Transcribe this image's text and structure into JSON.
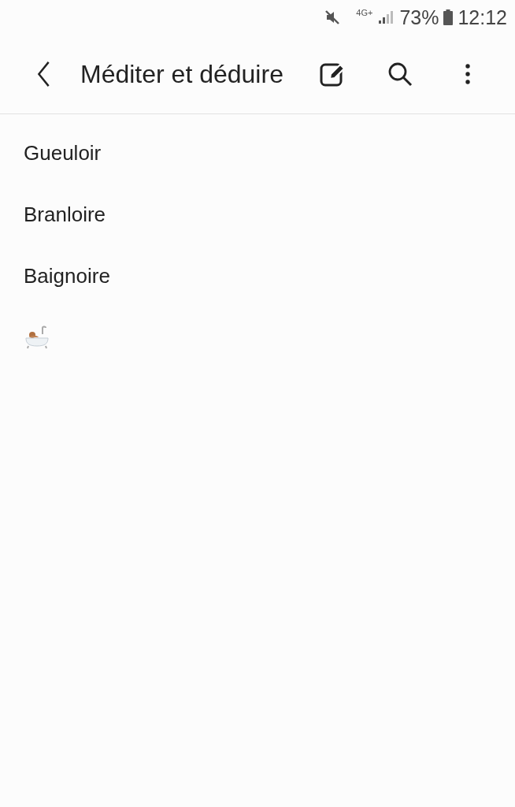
{
  "status_bar": {
    "network": "4G+",
    "battery": "73%",
    "time": "12:12"
  },
  "app_bar": {
    "title": "Méditer et déduire"
  },
  "lines": [
    {
      "kind": "text",
      "text": "Gueuloir"
    },
    {
      "kind": "text",
      "text": "Branloire"
    },
    {
      "kind": "text",
      "text": "Baignoire"
    },
    {
      "kind": "bathtub"
    }
  ]
}
